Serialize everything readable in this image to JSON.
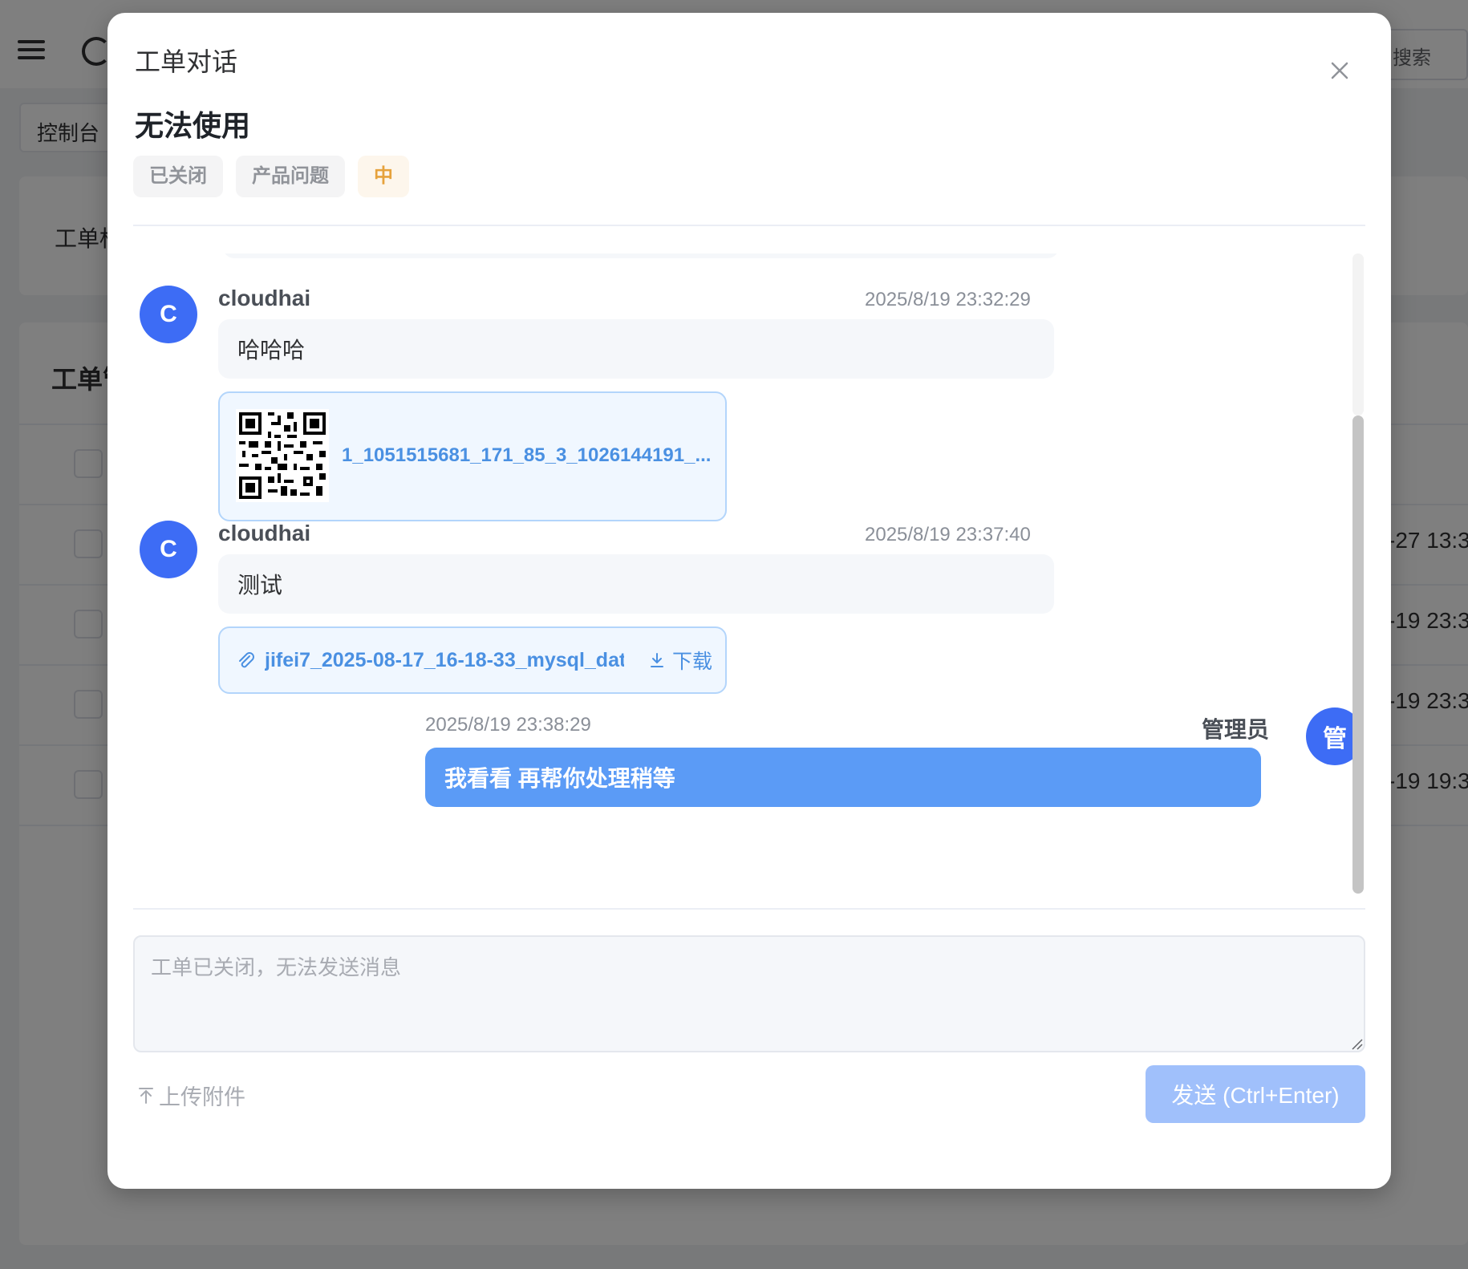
{
  "background": {
    "search_label": "搜索",
    "tab_label": "控制台",
    "card1_label": "工单标",
    "card2_title": "工单管",
    "table_dates": [
      "-27 13:3",
      "-19 23:3",
      "-19 23:3",
      "-19 19:3"
    ]
  },
  "dialog": {
    "title": "工单对话",
    "ticket_title": "无法使用",
    "tags": [
      {
        "label": "已关闭",
        "style": "gray"
      },
      {
        "label": "产品问题",
        "style": "gray"
      },
      {
        "label": "中",
        "style": "orange"
      }
    ],
    "messages": [
      {
        "avatar": "C",
        "sender": "cloudhai",
        "time": "2025/8/19 23:32:29",
        "text": "哈哈哈",
        "attachment": {
          "type": "image",
          "name": "1_1051515681_171_85_3_1026144191_..."
        }
      },
      {
        "avatar": "C",
        "sender": "cloudhai",
        "time": "2025/8/19 23:37:40",
        "text": "测试",
        "attachment": {
          "type": "file",
          "name": "jifei7_2025-08-17_16-18-33_mysql_dat...",
          "download_label": "下载"
        }
      },
      {
        "avatar": "管",
        "sender": "管理员",
        "time": "2025/8/19 23:38:29",
        "text": "我看看 再帮你处理稍等",
        "mine": true
      }
    ],
    "input_placeholder": "工单已关闭，无法发送消息",
    "upload_label": "上传附件",
    "send_label": "发送 (Ctrl+Enter)"
  },
  "colors": {
    "avatar": "#3d6cf5",
    "mine_bubble": "#5b9bf6",
    "link": "#4a90e2",
    "send_disabled": "#a0c0fb",
    "priority_orange": "#e6a23c"
  }
}
